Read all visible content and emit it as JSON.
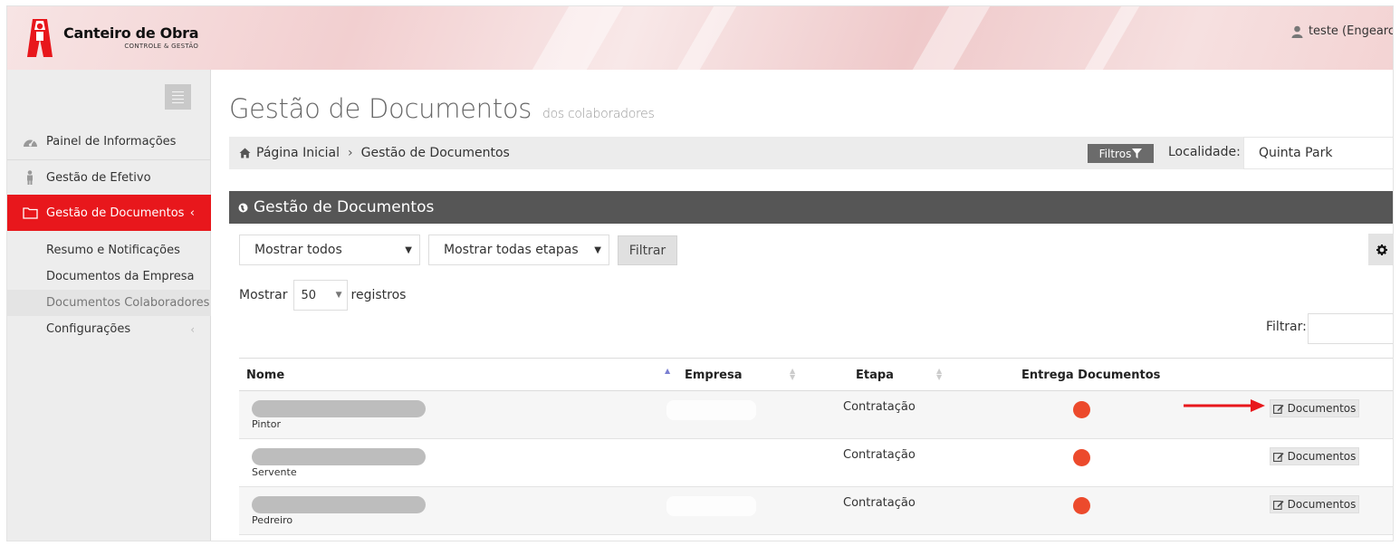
{
  "header": {
    "logo_title": "Canteiro de Obra",
    "logo_subtitle": "CONTROLE & GESTÃO",
    "user_label": "teste (Engearc",
    "icons": {
      "user": "user-icon"
    }
  },
  "sidebar": {
    "items": [
      {
        "label": "Painel de Informações",
        "icon": "dashboard-icon"
      },
      {
        "label": "Gestão de Efetivo",
        "icon": "person-icon"
      },
      {
        "label": "Gestão de Documentos",
        "icon": "folder-icon",
        "active": true
      }
    ],
    "subitems": [
      {
        "label": "Resumo e Notificações"
      },
      {
        "label": "Documentos da Empresa"
      },
      {
        "label": "Documentos Colaboradores",
        "current": true
      },
      {
        "label": "Configurações",
        "has_submenu": true
      }
    ]
  },
  "page": {
    "title": "Gestão de Documentos",
    "subtitle": "dos colaboradores"
  },
  "breadcrumb": {
    "home": "Página Inicial",
    "current": "Gestão de Documentos"
  },
  "filters": {
    "button": "Filtros",
    "location_label": "Localidade:",
    "location_value": "Quinta Park"
  },
  "panel": {
    "title": "Gestão de Documentos",
    "select_status": "Mostrar todos",
    "select_stage": "Mostrar todas etapas",
    "filter_button": "Filtrar"
  },
  "table_controls": {
    "show_label": "Mostrar",
    "page_length": "50",
    "records_label": "registros",
    "search_label": "Filtrar:"
  },
  "table": {
    "columns": [
      "Nome",
      "Empresa",
      "Etapa",
      "Entrega Documentos"
    ],
    "rows": [
      {
        "role": "Pintor",
        "etapa": "Contratação",
        "status_color": "#ec4a2c",
        "action": "Documentos"
      },
      {
        "role": "Servente",
        "etapa": "Contratação",
        "status_color": "#ec4a2c",
        "action": "Documentos"
      },
      {
        "role": "Pedreiro",
        "etapa": "Contratação",
        "status_color": "#ec4a2c",
        "action": "Documentos"
      }
    ]
  },
  "colors": {
    "accent": "#e8171c",
    "panel_header": "#565656",
    "annotation_arrow": "#e8171c"
  }
}
